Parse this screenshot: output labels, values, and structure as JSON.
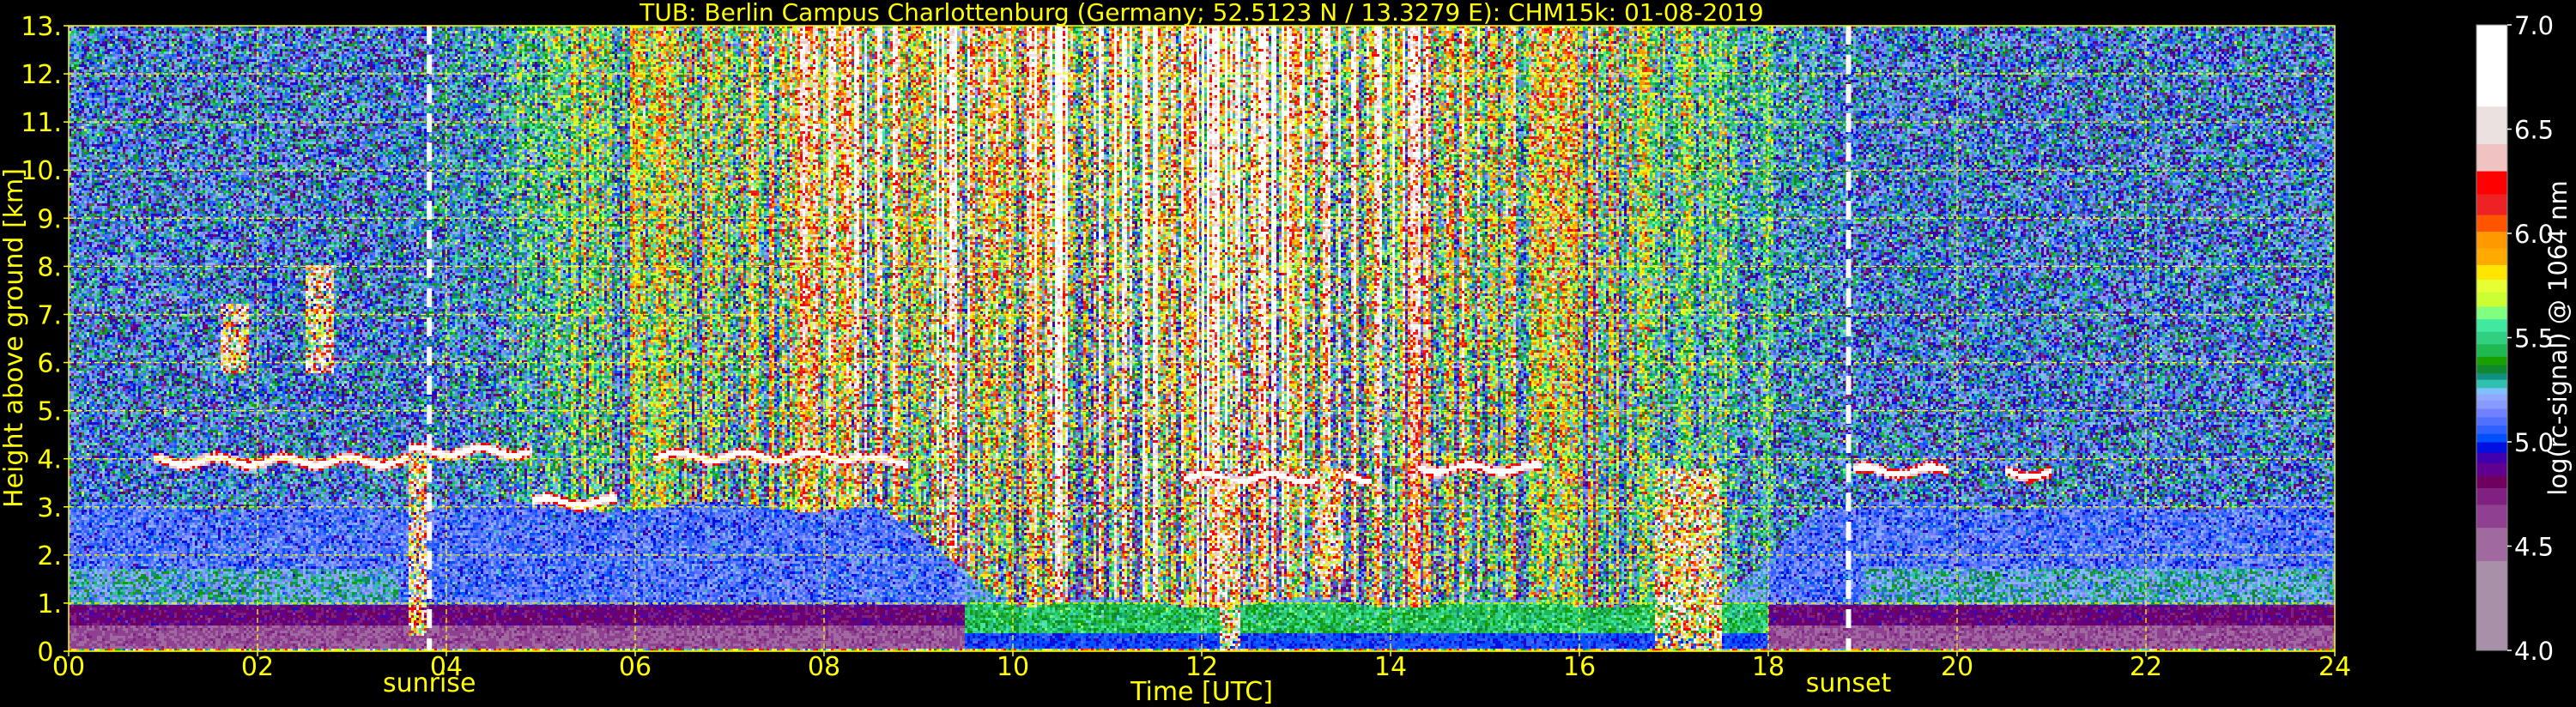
{
  "chart_data": {
    "type": "heatmap",
    "title": "TUB: Berlin Campus Charlottenburg (Germany; 52.5123 N / 13.3279 E):    CHM15k: 01-08-2019",
    "xlabel": "Time [UTC]",
    "ylabel": "Height above ground [km]",
    "xlim": [
      0,
      24
    ],
    "ylim": [
      0,
      13
    ],
    "x_ticks": [
      0,
      2,
      4,
      6,
      8,
      10,
      12,
      14,
      16,
      18,
      20,
      22,
      24
    ],
    "x_tick_labels": [
      "00",
      "02",
      "04",
      "06",
      "08",
      "10",
      "12",
      "14",
      "16",
      "18",
      "20",
      "22",
      "24"
    ],
    "y_ticks": [
      0,
      1,
      2,
      3,
      4,
      5,
      6,
      7,
      8,
      9,
      10,
      11,
      12,
      13
    ],
    "y_tick_labels": [
      "0.",
      "1.",
      "2.",
      "3.",
      "4.",
      "5.",
      "6.",
      "7.",
      "8.",
      "9.",
      "10.",
      "11.",
      "12.",
      "13."
    ],
    "grid": true,
    "grid_color": "#ffff00",
    "annotations": [
      {
        "label": "sunrise",
        "time": 3.82
      },
      {
        "label": "sunset",
        "time": 18.85
      }
    ],
    "colorbar": {
      "label": "log(rc-signal) @ 1064 nm",
      "range": [
        4.0,
        7.0
      ],
      "ticks": [
        4.0,
        4.5,
        5.0,
        5.5,
        6.0,
        6.5,
        7.0
      ],
      "tick_labels": [
        "4.0",
        "4.5",
        "5.0",
        "5.5",
        "6.0",
        "6.5",
        "7.0"
      ],
      "levels": [
        [
          4.0,
          "#a890a8"
        ],
        [
          4.43,
          "#a06aa0"
        ],
        [
          4.59,
          "#904090"
        ],
        [
          4.7,
          "#802080"
        ],
        [
          4.78,
          "#700060"
        ],
        [
          4.84,
          "#600090"
        ],
        [
          4.9,
          "#4000b0"
        ],
        [
          4.95,
          "#0010e0"
        ],
        [
          5.0,
          "#0050ff"
        ],
        [
          5.04,
          "#3060ff"
        ],
        [
          5.08,
          "#5070ff"
        ],
        [
          5.12,
          "#7080ff"
        ],
        [
          5.16,
          "#8899ff"
        ],
        [
          5.2,
          "#90a8ff"
        ],
        [
          5.23,
          "#80c0ff"
        ],
        [
          5.26,
          "#30c0b0"
        ],
        [
          5.3,
          "#109080"
        ],
        [
          5.33,
          "#108830"
        ],
        [
          5.37,
          "#18a000"
        ],
        [
          5.41,
          "#20b850"
        ],
        [
          5.47,
          "#30d080"
        ],
        [
          5.53,
          "#40e8a0"
        ],
        [
          5.59,
          "#80ff80"
        ],
        [
          5.65,
          "#ccff33"
        ],
        [
          5.72,
          "#e6ff33"
        ],
        [
          5.78,
          "#ffe600"
        ],
        [
          5.85,
          "#ffaa00"
        ],
        [
          5.93,
          "#ff9900"
        ],
        [
          6.01,
          "#ff5500"
        ],
        [
          6.09,
          "#ee2222"
        ],
        [
          6.19,
          "#ff0000"
        ],
        [
          6.3,
          "#f0c3c3"
        ],
        [
          6.43,
          "#ebe1e1"
        ],
        [
          6.61,
          "#ffffff"
        ]
      ]
    },
    "cloud_layers": [
      {
        "time": [
          0.9,
          3.6
        ],
        "height": 3.95
      },
      {
        "time": [
          3.6,
          4.9
        ],
        "height": 4.15
      },
      {
        "time": [
          4.9,
          5.8
        ],
        "height": 3.1
      },
      {
        "time": [
          6.2,
          8.4
        ],
        "height": 4.05
      },
      {
        "time": [
          8.4,
          8.9
        ],
        "height": 3.95
      },
      {
        "time": [
          11.8,
          13.8
        ],
        "height": 3.6
      },
      {
        "time": [
          14.3,
          15.6
        ],
        "height": 3.8
      },
      {
        "time": [
          18.9,
          19.9
        ],
        "height": 3.75
      },
      {
        "time": [
          20.5,
          21.0
        ],
        "height": 3.7
      }
    ],
    "fallstreaks": [
      {
        "time": [
          3.6,
          3.8
        ],
        "height": [
          0.3,
          4.1
        ]
      },
      {
        "time": [
          12.2,
          12.4
        ],
        "height": [
          0.0,
          3.6
        ]
      },
      {
        "time": [
          13.2,
          13.5
        ],
        "height": [
          1.5,
          3.8
        ]
      },
      {
        "time": [
          16.8,
          17.5
        ],
        "height": [
          0.0,
          3.8
        ]
      },
      {
        "time": [
          1.6,
          1.9
        ],
        "height": [
          5.8,
          7.2
        ]
      },
      {
        "time": [
          2.5,
          2.8
        ],
        "height": [
          5.8,
          8.0
        ]
      }
    ],
    "aerosol_top_km": [
      [
        0,
        3.0
      ],
      [
        8.5,
        3.0
      ],
      [
        10,
        1.0
      ],
      [
        17.5,
        1.0
      ],
      [
        18.5,
        3.0
      ],
      [
        24,
        3.0
      ]
    ]
  }
}
